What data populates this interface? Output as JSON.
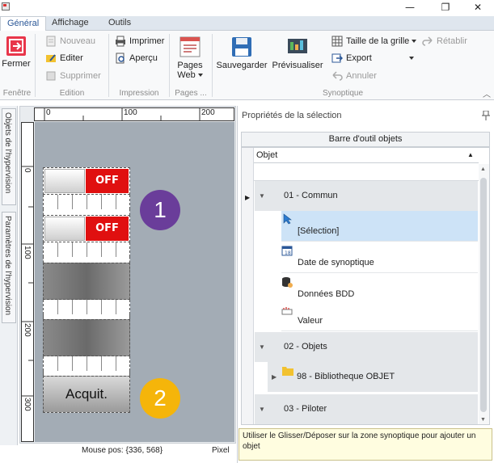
{
  "ribbon": {
    "tabs": [
      "Général",
      "Affichage",
      "Outils"
    ],
    "fenetre": {
      "label": "Fenêtre",
      "close": "Fermer"
    },
    "edition": {
      "label": "Edition",
      "new": "Nouveau",
      "edit": "Editer",
      "delete": "Supprimer"
    },
    "impression": {
      "label": "Impression",
      "print": "Imprimer",
      "preview": "Aperçu"
    },
    "pages": {
      "label": "Pages ...",
      "web_line1": "Pages",
      "web_line2": "Web"
    },
    "synoptique": {
      "label": "Synoptique",
      "save": "Sauvegarder",
      "preview": "Prévisualiser",
      "grid_size": "Taille de la grille",
      "export": "Export",
      "undo": "Annuler",
      "redo": "Rétablir"
    }
  },
  "left_tabs": [
    "Objets de l'hypervision",
    "Paramètres de l'hypervision"
  ],
  "ruler": {
    "top": [
      "0",
      "100",
      "200"
    ],
    "left": [
      "0",
      "100",
      "200",
      "300"
    ]
  },
  "canvas": {
    "switch_off_label": "OFF",
    "acquit_label": "Acquit.",
    "badges": [
      "1",
      "2"
    ]
  },
  "status": {
    "mouse": "Mouse pos: {336, 568}",
    "unit": "Pixel"
  },
  "panel": {
    "title": "Propriétés de la sélection",
    "toolbar_header": "Barre d'outil objets",
    "column": "Objet",
    "categories": [
      "01 - Commun",
      "02 - Objets",
      "03 - Piloter"
    ],
    "items": [
      "[Sélection]",
      "Date de synoptique",
      "Données BDD",
      "Valeur"
    ],
    "sub_item": "98 - Bibliotheque OBJET",
    "tip": "Utiliser le Glisser/Déposer sur la zone synoptique pour ajouter un objet"
  },
  "colors": {
    "accent": "#2b5797",
    "off_red": "#e01010",
    "badge1": "#6a3d9a",
    "badge2": "#f5b50a"
  }
}
